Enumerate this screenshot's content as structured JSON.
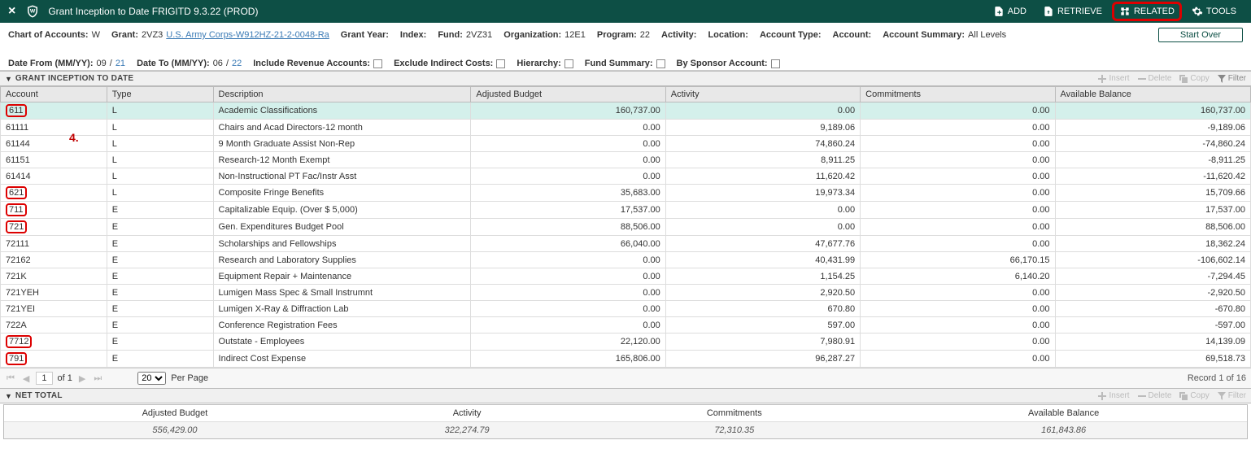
{
  "header": {
    "title": "Grant Inception to Date FRIGITD 9.3.22 (PROD)",
    "actions": {
      "add": "ADD",
      "retrieve": "RETRIEVE",
      "related": "RELATED",
      "tools": "TOOLS"
    }
  },
  "params": {
    "chart_label": "Chart of Accounts:",
    "chart_val": "W",
    "grant_label": "Grant:",
    "grant_val": "2VZ3",
    "grant_link": "U.S. Army Corps-W912HZ-21-2-0048-Ra",
    "grant_year_label": "Grant Year:",
    "index_label": "Index:",
    "fund_label": "Fund:",
    "fund_val": "2VZ31",
    "org_label": "Organization:",
    "org_val": "12E1",
    "program_label": "Program:",
    "program_val": "22",
    "activity_label": "Activity:",
    "location_label": "Location:",
    "account_type_label": "Account Type:",
    "account_label": "Account:",
    "account_summary_label": "Account Summary:",
    "account_summary_val": "All Levels",
    "date_from_label": "Date From (MM/YY):",
    "date_from_mm": "09",
    "date_from_yy": "21",
    "date_to_label": "Date To (MM/YY):",
    "date_to_mm": "06",
    "date_to_yy": "22",
    "include_rev_label": "Include Revenue Accounts:",
    "exclude_indirect_label": "Exclude Indirect Costs:",
    "hierarchy_label": "Hierarchy:",
    "fund_summary_label": "Fund Summary:",
    "by_sponsor_label": "By Sponsor Account:",
    "start_over": "Start Over"
  },
  "section1": {
    "title": "GRANT INCEPTION TO DATE"
  },
  "section_tools": {
    "insert": "Insert",
    "delete": "Delete",
    "copy": "Copy",
    "filter": "Filter"
  },
  "columns": {
    "account": "Account",
    "type": "Type",
    "desc": "Description",
    "budget": "Adjusted Budget",
    "activity": "Activity",
    "commit": "Commitments",
    "balance": "Available Balance"
  },
  "rows": [
    {
      "account": "611",
      "boxed": true,
      "type": "L",
      "desc": "Academic Classifications",
      "budget": "160,737.00",
      "activity": "0.00",
      "commit": "0.00",
      "balance": "160,737.00",
      "selected": true
    },
    {
      "account": "61111",
      "type": "L",
      "desc": "Chairs and Acad Directors-12 month",
      "budget": "0.00",
      "activity": "9,189.06",
      "commit": "0.00",
      "balance": "-9,189.06"
    },
    {
      "account": "61144",
      "type": "L",
      "desc": "9 Month Graduate Assist Non-Rep",
      "budget": "0.00",
      "activity": "74,860.24",
      "commit": "0.00",
      "balance": "-74,860.24"
    },
    {
      "account": "61151",
      "type": "L",
      "desc": "Research-12 Month Exempt",
      "budget": "0.00",
      "activity": "8,911.25",
      "commit": "0.00",
      "balance": "-8,911.25"
    },
    {
      "account": "61414",
      "type": "L",
      "desc": "Non-Instructional PT Fac/Instr Asst",
      "budget": "0.00",
      "activity": "11,620.42",
      "commit": "0.00",
      "balance": "-11,620.42"
    },
    {
      "account": "621",
      "boxed": true,
      "type": "L",
      "desc": "Composite Fringe Benefits",
      "budget": "35,683.00",
      "activity": "19,973.34",
      "commit": "0.00",
      "balance": "15,709.66"
    },
    {
      "account": "711",
      "boxed": true,
      "type": "E",
      "desc": "Capitalizable Equip. (Over $ 5,000)",
      "budget": "17,537.00",
      "activity": "0.00",
      "commit": "0.00",
      "balance": "17,537.00"
    },
    {
      "account": "721",
      "boxed": true,
      "type": "E",
      "desc": "Gen. Expenditures Budget Pool",
      "budget": "88,506.00",
      "activity": "0.00",
      "commit": "0.00",
      "balance": "88,506.00"
    },
    {
      "account": "72111",
      "type": "E",
      "desc": "Scholarships and Fellowships",
      "budget": "66,040.00",
      "activity": "47,677.76",
      "commit": "0.00",
      "balance": "18,362.24"
    },
    {
      "account": "72162",
      "type": "E",
      "desc": "Research and Laboratory Supplies",
      "budget": "0.00",
      "activity": "40,431.99",
      "commit": "66,170.15",
      "balance": "-106,602.14"
    },
    {
      "account": "721K",
      "type": "E",
      "desc": "Equipment Repair + Maintenance",
      "budget": "0.00",
      "activity": "1,154.25",
      "commit": "6,140.20",
      "balance": "-7,294.45"
    },
    {
      "account": "721YEH",
      "type": "E",
      "desc": "Lumigen Mass Spec & Small Instrumnt",
      "budget": "0.00",
      "activity": "2,920.50",
      "commit": "0.00",
      "balance": "-2,920.50"
    },
    {
      "account": "721YEI",
      "type": "E",
      "desc": "Lumigen X-Ray & Diffraction Lab",
      "budget": "0.00",
      "activity": "670.80",
      "commit": "0.00",
      "balance": "-670.80"
    },
    {
      "account": "722A",
      "type": "E",
      "desc": "Conference Registration Fees",
      "budget": "0.00",
      "activity": "597.00",
      "commit": "0.00",
      "balance": "-597.00"
    },
    {
      "account": "7712",
      "boxed": true,
      "type": "E",
      "desc": "Outstate - Employees",
      "budget": "22,120.00",
      "activity": "7,980.91",
      "commit": "0.00",
      "balance": "14,139.09"
    },
    {
      "account": "791",
      "boxed": true,
      "type": "E",
      "desc": "Indirect Cost Expense",
      "budget": "165,806.00",
      "activity": "96,287.27",
      "commit": "0.00",
      "balance": "69,518.73"
    }
  ],
  "pager": {
    "page": "1",
    "of": "of 1",
    "per_page": "Per Page",
    "per_page_val": "20",
    "record": "Record 1 of 16"
  },
  "section2": {
    "title": "NET TOTAL"
  },
  "totals": {
    "budget_label": "Adjusted Budget",
    "budget_val": "556,429.00",
    "activity_label": "Activity",
    "activity_val": "322,274.79",
    "commit_label": "Commitments",
    "commit_val": "72,310.35",
    "balance_label": "Available Balance",
    "balance_val": "161,843.86"
  },
  "annotation": {
    "four": "4."
  }
}
